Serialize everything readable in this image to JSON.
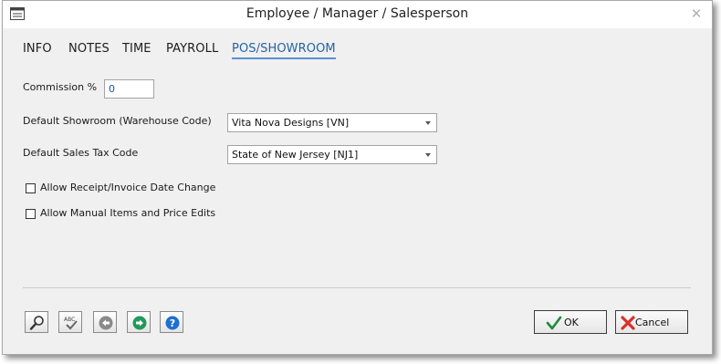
{
  "window": {
    "title": "Employee / Manager / Salesperson",
    "app_icon": "window-icon",
    "close_symbol": "✕"
  },
  "tabs": [
    {
      "label": "INFO",
      "active": false
    },
    {
      "label": "NOTES",
      "active": false
    },
    {
      "label": "TIME",
      "active": false
    },
    {
      "label": "PAYROLL",
      "active": false
    },
    {
      "label": "POS/SHOWROOM",
      "active": true
    }
  ],
  "form": {
    "commission_label": "Commission %",
    "commission_value": "0",
    "showroom_label": "Default Showroom (Warehouse Code)",
    "showroom_value": "Vita Nova Designs [VN]",
    "tax_label": "Default Sales Tax Code",
    "tax_value": "State of New Jersey [NJ1]",
    "allow_date_change_label": "Allow Receipt/Invoice Date Change",
    "allow_date_change_checked": false,
    "allow_manual_label": "Allow Manual Items and Price Edits",
    "allow_manual_checked": false
  },
  "toolbar": {
    "icons": [
      "magnifier-icon",
      "spellcheck-icon",
      "back-arrow-icon",
      "forward-arrow-icon",
      "help-icon"
    ],
    "spell_text": "ABC",
    "help_text": "?"
  },
  "actions": {
    "ok_label": "OK",
    "cancel_label": "Cancel"
  },
  "colors": {
    "active_tab": "#2563a8",
    "input_text": "#1f4fb3",
    "ok_check": "#1f8a3a",
    "cancel_x": "#d6312b",
    "nav_arrow_grey": "#8a8a8a",
    "nav_arrow_green": "#1f9a5a",
    "help_blue": "#1e6fd0"
  }
}
